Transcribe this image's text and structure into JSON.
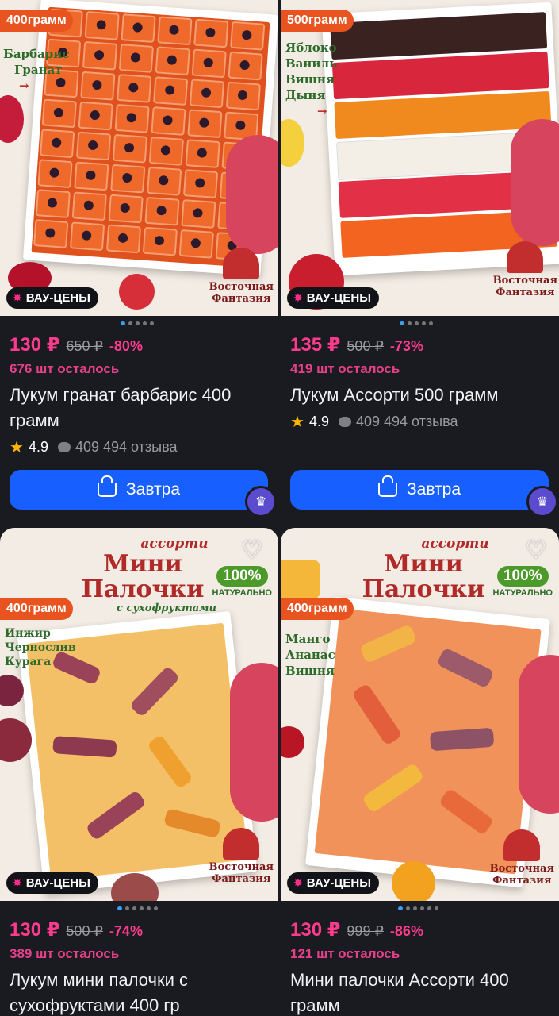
{
  "cards": [
    {
      "weight": "400грамм",
      "flavors": [
        "Барбарис",
        "Гранат"
      ],
      "badge": "ВАУ-ЦЕНЫ",
      "brand": [
        "Восточная",
        "Фантазия"
      ],
      "price": "130 ₽",
      "old_price": "650 ₽",
      "discount": "-80%",
      "left": "676 шт осталось",
      "name": "Лукум гранат барбарис 400 грамм",
      "rating": "4.9",
      "reviews": "409 494 отзыва",
      "button": "Завтра"
    },
    {
      "weight": "500грамм",
      "flavors": [
        "Яблоко",
        "Ваниль",
        "Вишня",
        "Дыня"
      ],
      "badge": "ВАУ-ЦЕНЫ",
      "brand": [
        "Восточная",
        "Фантазия"
      ],
      "price": "135 ₽",
      "old_price": "500 ₽",
      "discount": "-73%",
      "left": "419 шт осталось",
      "name": "Лукум Ассорти 500 грамм",
      "rating": "4.9",
      "reviews": "409 494 отзыва",
      "button": "Завтра"
    },
    {
      "banner_small": "ассорти",
      "banner_big": [
        "Мини",
        "Палочки"
      ],
      "banner_sub": "с сухофруктами",
      "natural_pct": "100%",
      "natural_lbl": "НАТУРАЛЬНО",
      "weight": "400грамм",
      "flavors": [
        "Инжир",
        "Чернослив",
        "Курага"
      ],
      "badge": "ВАУ-ЦЕНЫ",
      "brand": [
        "Восточная",
        "Фантазия"
      ],
      "price": "130 ₽",
      "old_price": "500 ₽",
      "discount": "-74%",
      "left": "389 шт осталось",
      "name": "Лукум мини палочки с сухофруктами 400 гр"
    },
    {
      "banner_small": "ассорти",
      "banner_big": [
        "Мини",
        "Палочки"
      ],
      "natural_pct": "100%",
      "natural_lbl": "НАТУРАЛЬНО",
      "weight": "400грамм",
      "flavors": [
        "Манго",
        "Ананас",
        "Вишня"
      ],
      "badge": "ВАУ-ЦЕНЫ",
      "brand": [
        "Восточная",
        "Фантазия"
      ],
      "price": "130 ₽",
      "old_price": "999 ₽",
      "discount": "-86%",
      "left": "121 шт осталось",
      "name": "Мини палочки Ассорти 400 грамм"
    }
  ],
  "colors": {
    "background": "#1a1b20",
    "accent_pink": "#ff3b8d",
    "button_blue": "#1760ff",
    "weight_badge": "#e8531f"
  },
  "icons": {
    "badge": "sparkle-icon",
    "rating": "star-icon",
    "reviews": "chat-bubble-icon",
    "button": "basket-icon",
    "premium": "crown-icon",
    "favorite": "heart-icon"
  }
}
